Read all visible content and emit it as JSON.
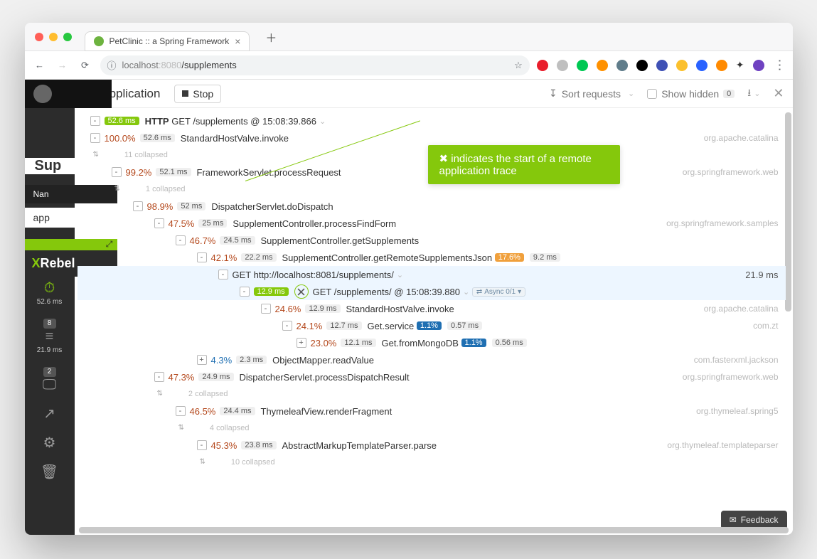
{
  "browser": {
    "tab_title": "PetClinic :: a Spring Framework",
    "url_host": "localhost",
    "url_port": ":8080",
    "url_path": "/supplements"
  },
  "app": {
    "section_title": "Application",
    "stop_label": "Stop",
    "sort_label": "Sort requests",
    "show_hidden_label": "Show hidden",
    "hidden_count": "0",
    "callout_text": "indicates the start of a remote application trace",
    "feedback": "Feedback"
  },
  "sidebar": {
    "peek_sup": "Sup",
    "peek_name": "Nan",
    "peek_app": "app",
    "brand_x": "X",
    "brand_rest": "Rebel",
    "items": [
      {
        "icon": "stopwatch",
        "value": "52.6 ms"
      },
      {
        "count": "8",
        "icon": "stack",
        "value": "21.9 ms"
      },
      {
        "count": "2",
        "icon": "monitor",
        "value": ""
      }
    ]
  },
  "trace": {
    "root": {
      "time": "52.6 ms",
      "kind": "HTTP",
      "label": "GET /supplements @ 15:08:39.866"
    },
    "r1": {
      "toggle": "-",
      "pct": "100.0%",
      "ms": "52.6 ms",
      "label": "StandardHostValve.invoke",
      "pkg": "org.apache.catalina",
      "collapsed": "11 collapsed"
    },
    "r2": {
      "toggle": "-",
      "pct": "99.2%",
      "ms": "52.1 ms",
      "label": "FrameworkServlet.processRequest",
      "pkg": "org.springframework.web",
      "collapsed": "1 collapsed"
    },
    "r3": {
      "toggle": "-",
      "pct": "98.9%",
      "ms": "52 ms",
      "label": "DispatcherServlet.doDispatch"
    },
    "r4": {
      "toggle": "-",
      "pct": "47.5%",
      "ms": "25 ms",
      "label": "SupplementController.processFindForm",
      "pkg": "org.springframework.samples"
    },
    "r5": {
      "toggle": "-",
      "pct": "46.7%",
      "ms": "24.5 ms",
      "label": "SupplementController.getSupplements"
    },
    "r6": {
      "toggle": "-",
      "pct": "42.1%",
      "ms": "22.2 ms",
      "label": "SupplementController.getRemoteSupplementsJson",
      "badge_pct": "17.6%",
      "badge_ms": "9.2 ms"
    },
    "r7": {
      "toggle": "-",
      "label": "GET http://localhost:8081/supplements/",
      "right": "21.9 ms"
    },
    "r8": {
      "toggle": "-",
      "ms": "12.9 ms",
      "label": "GET /supplements/ @ 15:08:39.880",
      "async": "Async 0/1"
    },
    "r9": {
      "toggle": "-",
      "pct": "24.6%",
      "ms": "12.9 ms",
      "label": "StandardHostValve.invoke",
      "pkg": "org.apache.catalina"
    },
    "r10": {
      "toggle": "-",
      "pct": "24.1%",
      "ms": "12.7 ms",
      "label": "Get.service",
      "badge_pct": "1.1%",
      "badge_ms": "0.57 ms",
      "pkg": "com.zt"
    },
    "r11": {
      "toggle": "+",
      "pct": "23.0%",
      "ms": "12.1 ms",
      "label": "Get.fromMongoDB",
      "badge_pct": "1.1%",
      "badge_ms": "0.56 ms"
    },
    "r12": {
      "toggle": "+",
      "pct": "4.3%",
      "ms": "2.3 ms",
      "label": "ObjectMapper.readValue",
      "pkg": "com.fasterxml.jackson"
    },
    "r13": {
      "toggle": "-",
      "pct": "47.3%",
      "ms": "24.9 ms",
      "label": "DispatcherServlet.processDispatchResult",
      "pkg": "org.springframework.web",
      "collapsed": "2 collapsed"
    },
    "r14": {
      "toggle": "-",
      "pct": "46.5%",
      "ms": "24.4 ms",
      "label": "ThymeleafView.renderFragment",
      "pkg": "org.thymeleaf.spring5",
      "collapsed": "4 collapsed"
    },
    "r15": {
      "toggle": "-",
      "pct": "45.3%",
      "ms": "23.8 ms",
      "label": "AbstractMarkupTemplateParser.parse",
      "pkg": "org.thymeleaf.templateparser",
      "collapsed": "10 collapsed"
    }
  }
}
